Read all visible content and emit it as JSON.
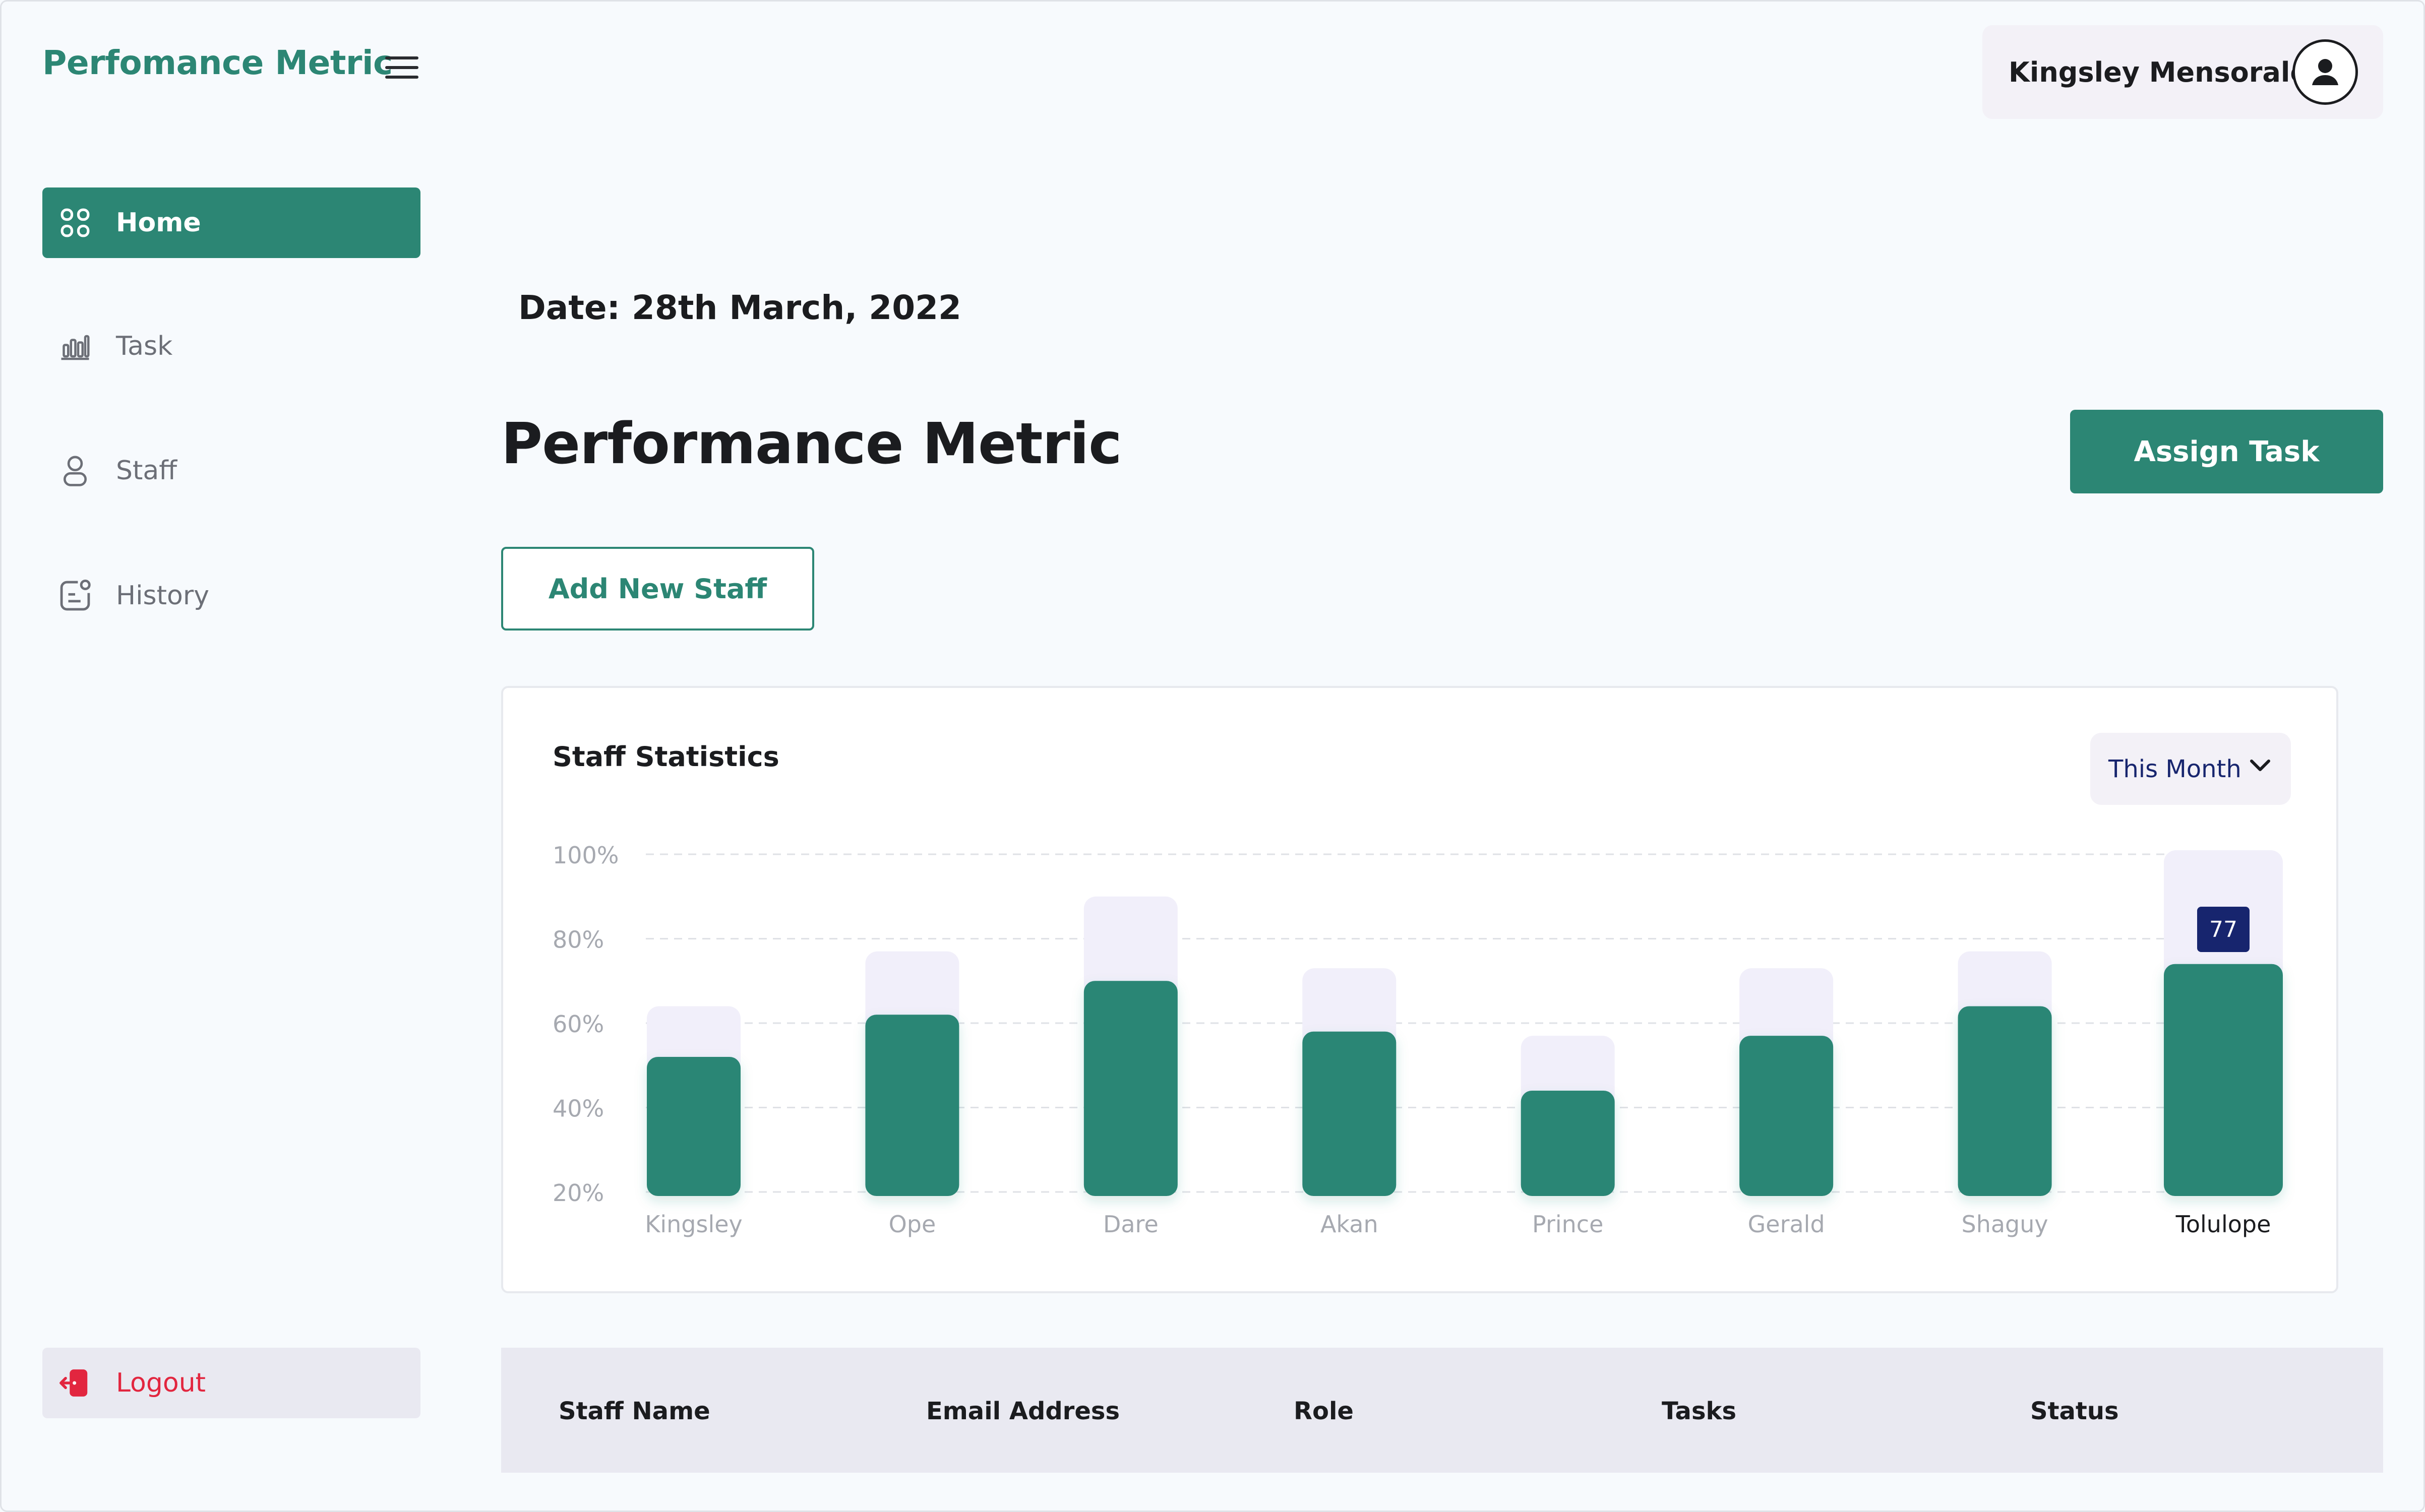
{
  "app": {
    "brand": "Perfomance Metric",
    "user_name": "Kingsley Mensorale"
  },
  "sidebar": {
    "items": [
      {
        "label": "Home",
        "icon": "grid-icon",
        "active": true
      },
      {
        "label": "Task",
        "icon": "bar-chart-icon",
        "active": false
      },
      {
        "label": "Staff",
        "icon": "user-icon",
        "active": false
      },
      {
        "label": "History",
        "icon": "history-icon",
        "active": false
      }
    ],
    "logout_label": "Logout"
  },
  "main": {
    "date": "Date: 28th March, 2022",
    "title": "Performance Metric",
    "assign_task_label": "Assign Task",
    "add_staff_label": "Add New Staff"
  },
  "chart_card": {
    "title": "Staff Statistics",
    "period": "This Month"
  },
  "chart_data": {
    "type": "bar",
    "categories": [
      "Kingsley",
      "Ope",
      "Dare",
      "Akan",
      "Prince",
      "Gerald",
      "Shaguy",
      "Tolulope"
    ],
    "series": [
      {
        "values": [
          52,
          62,
          70,
          58,
          44,
          57,
          64,
          74
        ]
      },
      {
        "values": [
          64,
          77,
          90,
          73,
          57,
          73,
          77,
          100
        ]
      }
    ],
    "y_ticks": [
      "100%",
      "80%",
      "60%",
      "40%",
      "20%"
    ],
    "ylim": [
      20,
      100
    ],
    "highlight": {
      "category": "Tolulope",
      "label": "77"
    },
    "colors": {
      "value": "#2c8674",
      "track": "#f1effa",
      "tooltip": "#17256e"
    },
    "grid": true
  },
  "table": {
    "columns": [
      "Staff Name",
      "Email Address",
      "Role",
      "Tasks",
      "Status"
    ]
  }
}
